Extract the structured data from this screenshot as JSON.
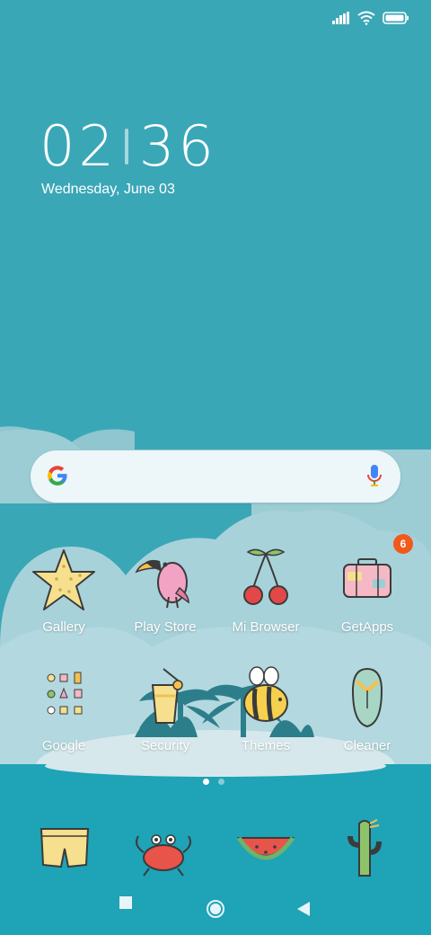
{
  "status_bar": {
    "icons": [
      "signal-icon",
      "wifi-icon",
      "battery-icon"
    ]
  },
  "clock": {
    "hours": "02",
    "minutes": "36",
    "date": "Wednesday, June 03"
  },
  "search": {
    "logo": "google-g-icon",
    "mic": "mic-icon"
  },
  "apps": [
    {
      "label": "Gallery"
    },
    {
      "label": "Play Store"
    },
    {
      "label": "Mi Browser"
    },
    {
      "label": "GetApps",
      "badge": "6"
    },
    {
      "label": "Google"
    },
    {
      "label": "Security"
    },
    {
      "label": "Themes"
    },
    {
      "label": "Cleaner"
    }
  ],
  "pages": {
    "count": 2,
    "current": 1
  },
  "dock": [
    "shorts-icon",
    "crab-icon",
    "watermelon-icon",
    "cactus-icon"
  ],
  "nav": {
    "buttons": [
      "recents-button",
      "home-button",
      "back-button"
    ]
  },
  "colors": {
    "sky": "#3aa7b7",
    "cloud": "#a9d3db",
    "sea": "#1fa3b6",
    "badge": "#f05a1a"
  }
}
